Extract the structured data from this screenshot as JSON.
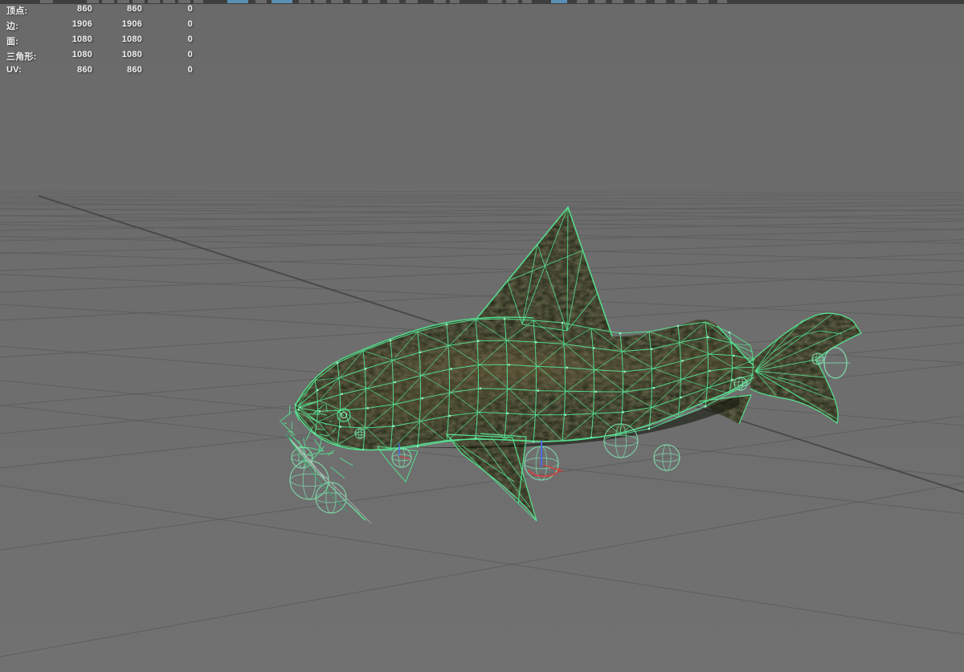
{
  "stats_panel": {
    "rows": [
      {
        "label": "顶点:",
        "col1": "860",
        "col2": "860",
        "col3": "0"
      },
      {
        "label": "边:",
        "col1": "1906",
        "col2": "1906",
        "col3": "0"
      },
      {
        "label": "面:",
        "col1": "1080",
        "col2": "1080",
        "col3": "0"
      },
      {
        "label": "三角形:",
        "col1": "1080",
        "col2": "1080",
        "col3": "0"
      },
      {
        "label": "UV:",
        "col1": "860",
        "col2": "860",
        "col3": "0"
      }
    ]
  },
  "icons": {
    "toolbar_buttons": "clipped-toolbar-button-icons",
    "joint_rings": "bone-joint-ring",
    "gizmo": "transform-axis-gizmo"
  },
  "colors": {
    "viewport_bg": "#6c6c6c",
    "viewport_bg_bottom": "#717171",
    "grid_line": "#5e5e5e",
    "grid_line_faint": "#646464",
    "grid_axis": "#4a4a4a",
    "toolbar_bg": "#3e3e3e",
    "toolbar_segment": "#6a6a6a",
    "toolbar_active": "#5b8fb5",
    "stats_text": "#f0f0f0",
    "wire_green": "#55e090",
    "wire_bright": "#98f5c6",
    "ring_green": "#7fe0ac",
    "gizmo_red": "#cc4444",
    "gizmo_blue": "#4a6ae0",
    "fish_base": "#1c2214",
    "fish_dark": "#12160c",
    "fish_highlight": "#6e5e3c",
    "whisker_gray": "#9aa59e"
  }
}
